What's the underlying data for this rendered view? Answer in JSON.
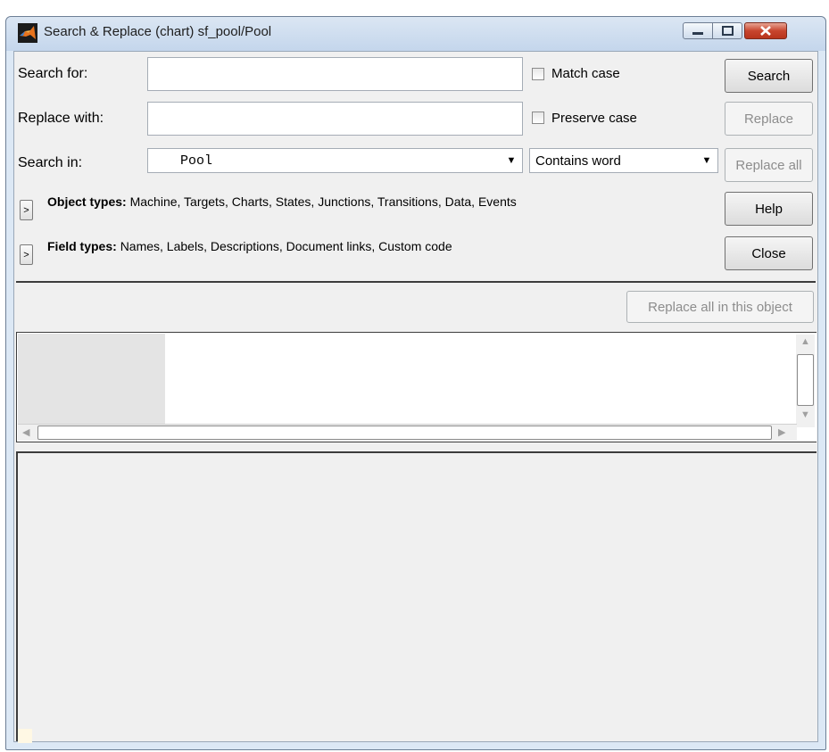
{
  "window": {
    "title": "Search & Replace (chart) sf_pool/Pool",
    "controls": [
      "minimize-icon",
      "maximize-icon",
      "close-icon"
    ]
  },
  "form": {
    "search_for_label": "Search for:",
    "search_for_value": "",
    "replace_with_label": "Replace with:",
    "replace_with_value": "",
    "search_in_label": "Search in:",
    "search_in_value": "Pool",
    "match_mode_value": "Contains word",
    "match_case_label": "Match case",
    "match_case_checked": false,
    "preserve_case_label": "Preserve case",
    "preserve_case_checked": false
  },
  "buttons": {
    "search": "Search",
    "replace": "Replace",
    "replace_all": "Replace all",
    "help": "Help",
    "close": "Close",
    "replace_all_in_object": "Replace all in this object"
  },
  "filters": {
    "object_types_label": "Object types:",
    "object_types_value": "Machine, Targets, Charts, States, Junctions, Transitions, Data, Events",
    "field_types_label": "Field types:",
    "field_types_value": "Names, Labels, Descriptions, Document links, Custom code",
    "expander_glyph": ">"
  },
  "colors": {
    "titlebar": "#c4d6ec",
    "client_bg": "#f0f0f0",
    "close_button": "#c8452e",
    "disabled_text": "#8d8d8d",
    "app_icon_orange": "#e8731d"
  }
}
